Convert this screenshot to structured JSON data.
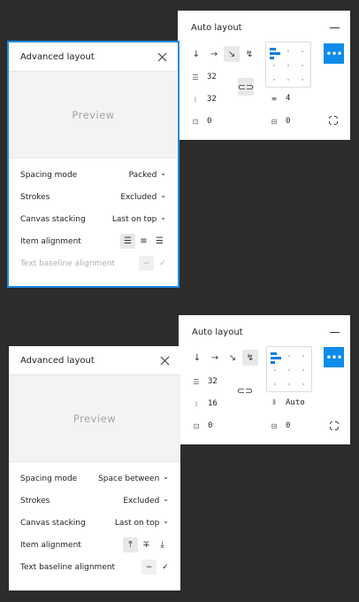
{
  "top": {
    "autolayout": {
      "title": "Auto layout",
      "directions": [
        "↓",
        "→",
        "⇲",
        "↯"
      ],
      "spacing": "32",
      "padding_horizontal": "32",
      "padding_vertical": "0",
      "spacing_grid": "4",
      "padding_bottom": "0"
    },
    "advanced": {
      "title": "Advanced layout",
      "preview": "Preview",
      "spacing_mode_label": "Spacing mode",
      "spacing_mode_value": "Packed",
      "strokes_label": "Strokes",
      "strokes_value": "Excluded",
      "canvas_stacking_label": "Canvas stacking",
      "canvas_stacking_value": "Last on top",
      "item_alignment_label": "Item alignment",
      "text_baseline_label": "Text baseline alignment",
      "minus": "−",
      "check": "✓"
    }
  },
  "bottom": {
    "autolayout": {
      "title": "Auto layout",
      "spacing": "32",
      "padding_horizontal": "16",
      "padding_vertical": "0",
      "spacing_grid": "Auto",
      "padding_bottom": "0"
    },
    "advanced": {
      "title": "Advanced layout",
      "preview": "Preview",
      "spacing_mode_label": "Spacing mode",
      "spacing_mode_value": "Space between",
      "strokes_label": "Strokes",
      "strokes_value": "Excluded",
      "canvas_stacking_label": "Canvas stacking",
      "canvas_stacking_value": "Last on top",
      "item_alignment_label": "Item alignment",
      "text_baseline_label": "Text baseline alignment",
      "minus": "−",
      "check": "✓"
    }
  },
  "colors": {
    "accent": "#0d8ce9",
    "selection": "#1e8ee8",
    "background": "#2c2c2c"
  }
}
